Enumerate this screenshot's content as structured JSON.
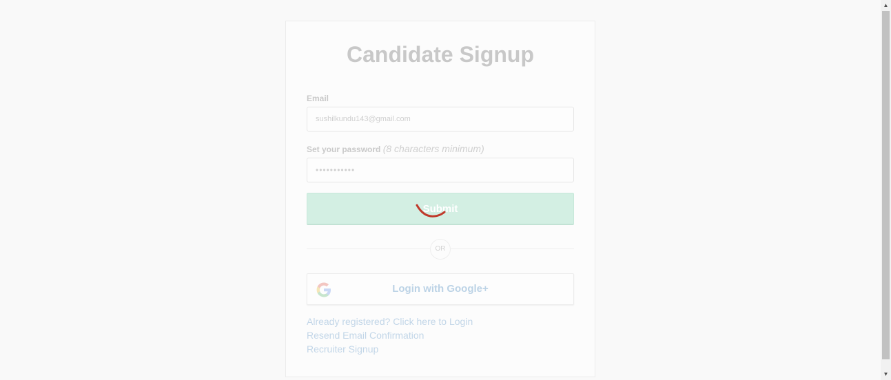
{
  "form": {
    "title": "Candidate Signup",
    "email_label": "Email",
    "email_value": "sushilkundu143@gmail.com",
    "password_label": "Set your password",
    "password_hint": "(8 characters minimum)",
    "password_value": "•••••••••••",
    "submit_label": "Submit",
    "divider_text": "OR",
    "google_label": "Login with Google+",
    "links": {
      "login": "Already registered? Click here to Login",
      "resend": "Resend Email Confirmation",
      "recruiter": "Recruiter Signup"
    }
  },
  "colors": {
    "submit_bg": "#d3efe3",
    "spinner": "#c0392b",
    "link": "#c2d6e8"
  },
  "icons": {
    "google": "google-g-icon",
    "spinner": "loading-spinner-icon",
    "scroll_up": "chevron-up-icon",
    "scroll_down": "chevron-down-icon"
  }
}
